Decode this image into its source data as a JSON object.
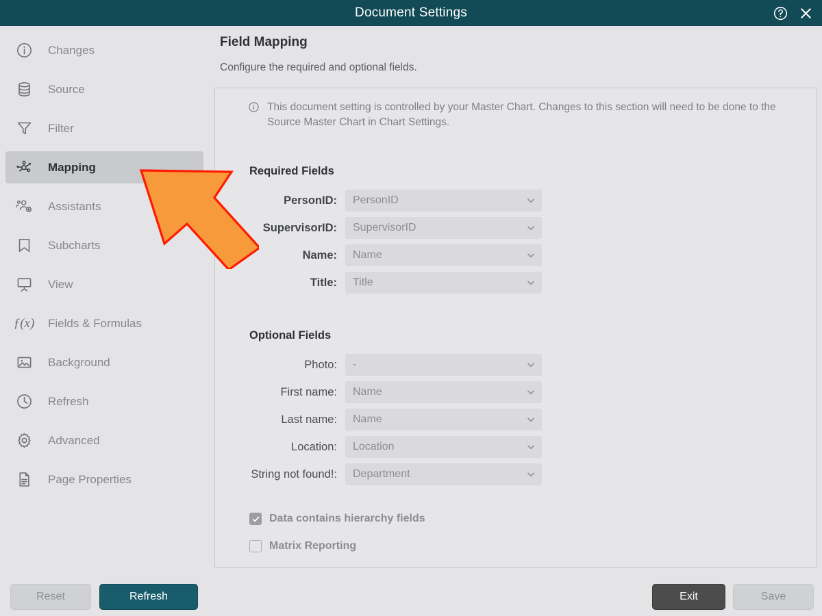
{
  "window": {
    "title": "Document Settings",
    "help_icon": "help-circle-icon",
    "close_icon": "close-icon"
  },
  "sidebar": {
    "items": [
      {
        "label": "Changes",
        "icon": "info-circle-icon",
        "active": false
      },
      {
        "label": "Source",
        "icon": "database-icon",
        "active": false
      },
      {
        "label": "Filter",
        "icon": "funnel-icon",
        "active": false
      },
      {
        "label": "Mapping",
        "icon": "node-graph-icon",
        "active": true
      },
      {
        "label": "Assistants",
        "icon": "people-add-icon",
        "active": false
      },
      {
        "label": "Subcharts",
        "icon": "bookmark-icon",
        "active": false
      },
      {
        "label": "View",
        "icon": "presentation-icon",
        "active": false
      },
      {
        "label": "Fields & Formulas",
        "icon": "function-icon",
        "active": false
      },
      {
        "label": "Background",
        "icon": "image-icon",
        "active": false
      },
      {
        "label": "Refresh",
        "icon": "clock-icon",
        "active": false
      },
      {
        "label": "Advanced",
        "icon": "gear-icon",
        "active": false
      },
      {
        "label": "Page Properties",
        "icon": "document-icon",
        "active": false
      }
    ]
  },
  "main": {
    "title": "Field Mapping",
    "subtitle": "Configure the required and optional fields.",
    "notice": {
      "icon": "info-circle-icon",
      "text": "This document setting is controlled by your Master Chart. Changes to this section will need to be done to the Source Master Chart in Chart Settings."
    },
    "required_section_title": "Required Fields",
    "required_fields": [
      {
        "label": "PersonID:",
        "value": "PersonID"
      },
      {
        "label": "SupervisorID:",
        "value": "SupervisorID"
      },
      {
        "label": "Name:",
        "value": "Name"
      },
      {
        "label": "Title:",
        "value": "Title"
      }
    ],
    "optional_section_title": "Optional Fields",
    "optional_fields": [
      {
        "label": "Photo:",
        "value": "-"
      },
      {
        "label": "First name:",
        "value": "Name"
      },
      {
        "label": "Last name:",
        "value": "Name"
      },
      {
        "label": "Location:",
        "value": "Location"
      },
      {
        "label": "String not found!:",
        "value": "Department"
      }
    ],
    "checkboxes": [
      {
        "label": "Data contains hierarchy fields",
        "checked": true
      },
      {
        "label": "Matrix Reporting",
        "checked": false
      }
    ]
  },
  "footer": {
    "reset_label": "Reset",
    "refresh_label": "Refresh",
    "exit_label": "Exit",
    "save_label": "Save"
  },
  "annotation": {
    "type": "arrow",
    "points_to": "sidebar-item-mapping",
    "fill": "#F79A3C",
    "stroke": "#FF1A00"
  },
  "colors": {
    "titlebar": "#124a56",
    "accent_teal": "#195d6d",
    "page_bg": "#e4e4e6",
    "panel_bg": "#e6e6e8",
    "field_bg": "#dadadc",
    "selected_item": "#c9cacd"
  }
}
